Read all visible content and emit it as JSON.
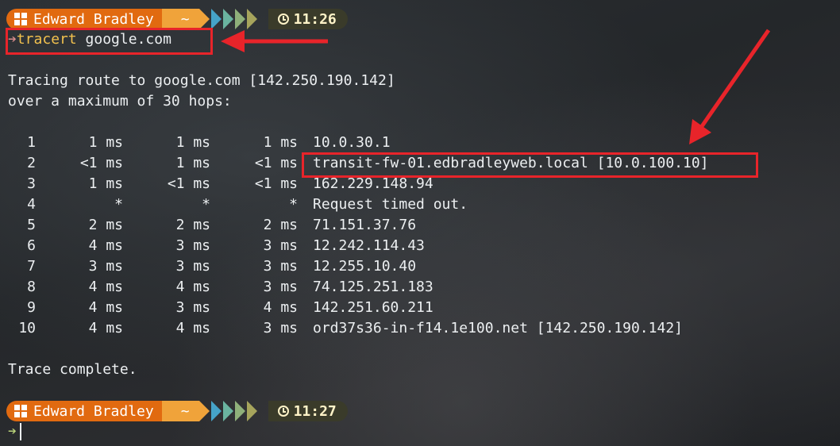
{
  "prompt1": {
    "user": "Edward Bradley",
    "dir": "~",
    "time": "11:26"
  },
  "command": {
    "name": "tracert",
    "arg": "google.com"
  },
  "output": {
    "header1": "Tracing route to google.com [142.250.190.142]",
    "header2": "over a maximum of 30 hops:",
    "hops": [
      {
        "hop": "1",
        "r1": "1 ms",
        "r2": "1 ms",
        "r3": "1 ms",
        "host": "10.0.30.1"
      },
      {
        "hop": "2",
        "r1": "<1 ms",
        "r2": "1 ms",
        "r3": "<1 ms",
        "host": "transit-fw-01.edbradleyweb.local [10.0.100.10]"
      },
      {
        "hop": "3",
        "r1": "1 ms",
        "r2": "<1 ms",
        "r3": "<1 ms",
        "host": "162.229.148.94"
      },
      {
        "hop": "4",
        "r1": "*",
        "r2": "*",
        "r3": "*",
        "host": "Request timed out."
      },
      {
        "hop": "5",
        "r1": "2 ms",
        "r2": "2 ms",
        "r3": "2 ms",
        "host": "71.151.37.76"
      },
      {
        "hop": "6",
        "r1": "4 ms",
        "r2": "3 ms",
        "r3": "3 ms",
        "host": "12.242.114.43"
      },
      {
        "hop": "7",
        "r1": "3 ms",
        "r2": "3 ms",
        "r3": "3 ms",
        "host": "12.255.10.40"
      },
      {
        "hop": "8",
        "r1": "4 ms",
        "r2": "4 ms",
        "r3": "3 ms",
        "host": "74.125.251.183"
      },
      {
        "hop": "9",
        "r1": "4 ms",
        "r2": "3 ms",
        "r3": "4 ms",
        "host": "142.251.60.211"
      },
      {
        "hop": "10",
        "r1": "4 ms",
        "r2": "4 ms",
        "r3": "3 ms",
        "host": "ord37s36-in-f14.1e100.net [142.250.190.142]"
      }
    ],
    "footer": "Trace complete."
  },
  "prompt2": {
    "user": "Edward Bradley",
    "dir": "~",
    "time": "11:27"
  },
  "colors": {
    "user_segment": "#e16a10",
    "dir_segment": "#f0a33a",
    "command": "#f2c14e",
    "annotation": "#e8242a"
  }
}
